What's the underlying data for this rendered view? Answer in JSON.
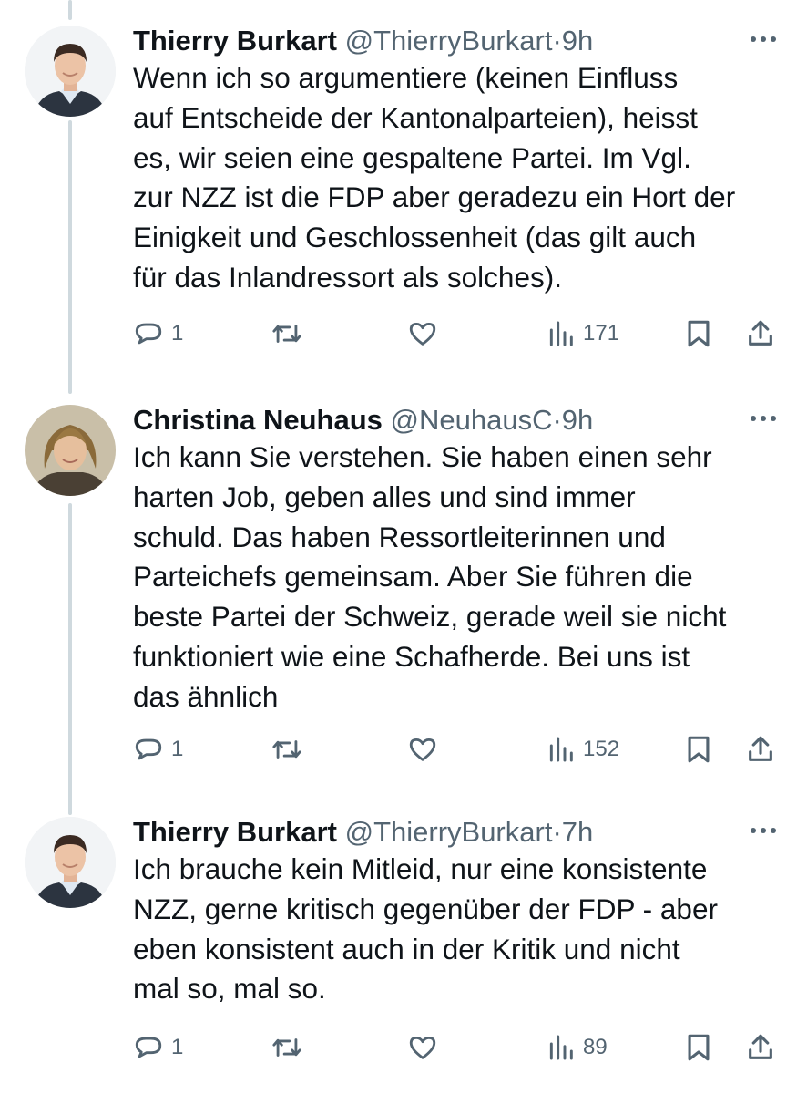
{
  "tweets": [
    {
      "author": "Thierry Burkart",
      "handle": "@ThierryBurkart",
      "separator": "·",
      "time": "9h",
      "text": "Wenn ich so argumentiere (keinen Einfluss\nauf Entscheide der Kantonalparteien), heisst\nes, wir seien eine gespaltene Partei. Im Vgl.\nzur NZZ ist die FDP aber geradezu ein Hort der\nEinigkeit und Geschlossenheit (das gilt auch\nfür das Inlandressort als solches).",
      "replies": "1",
      "views": "171"
    },
    {
      "author": "Christina Neuhaus",
      "handle": "@NeuhausC",
      "separator": "·",
      "time": "9h",
      "text": "Ich kann Sie verstehen. Sie haben einen sehr\nharten Job, geben alles und sind immer\nschuld. Das haben Ressortleiterinnen und\nParteichefs gemeinsam. Aber Sie führen die\nbeste Partei der Schweiz, gerade weil sie nicht\nfunktioniert wie eine Schafherde. Bei uns ist\ndas ähnlich",
      "replies": "1",
      "views": "152"
    },
    {
      "author": "Thierry Burkart",
      "handle": "@ThierryBurkart",
      "separator": "·",
      "time": "7h",
      "text": "Ich brauche kein Mitleid, nur eine konsistente\nNZZ, gerne kritisch gegenüber der FDP - aber\neben konsistent auch in der Kritik und nicht\nmal so, mal so.",
      "replies": "1",
      "views": "89"
    }
  ],
  "icons": {
    "reply": "speech-bubble-icon",
    "retweet": "retweet-arrows-icon",
    "like": "heart-icon",
    "views": "bar-chart-icon",
    "bookmark": "bookmark-icon",
    "share": "upload-arrow-icon",
    "more": "three-dots-icon"
  },
  "colors": {
    "text": "#0f1419",
    "secondary": "#536471",
    "thread_line": "#cfd9de",
    "background": "#ffffff"
  }
}
